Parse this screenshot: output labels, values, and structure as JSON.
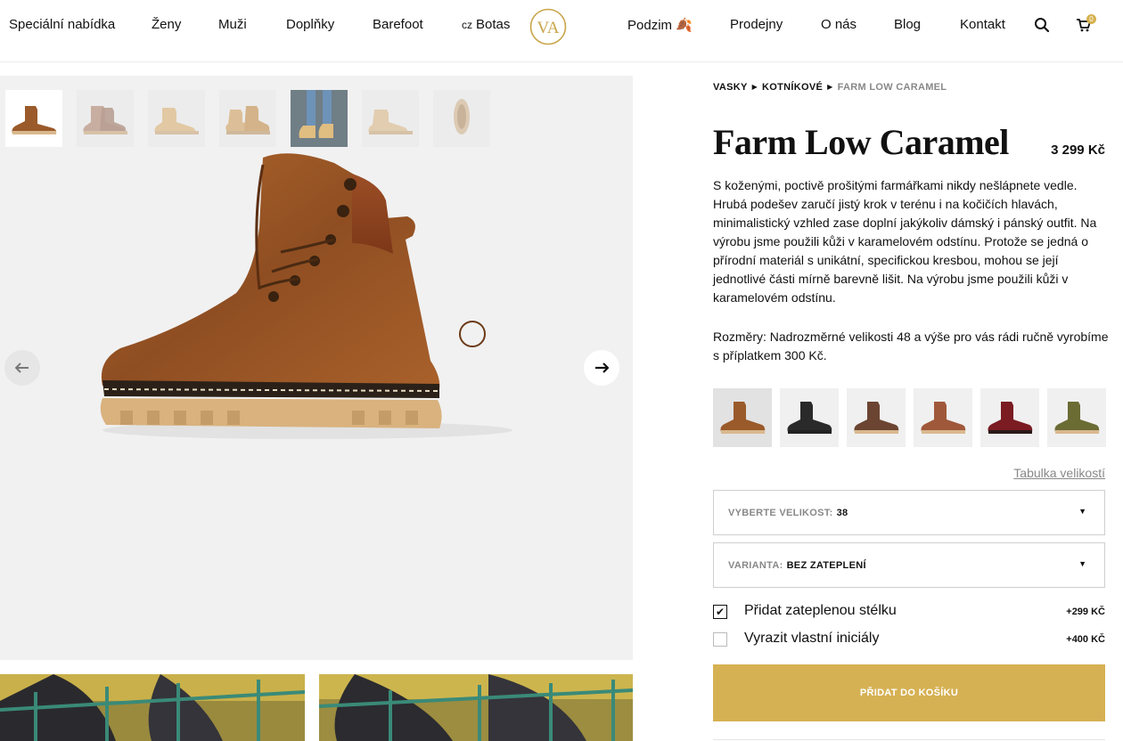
{
  "nav": {
    "left": [
      "Speciální nabídka",
      "Ženy",
      "Muži",
      "Doplňky",
      "Barefoot"
    ],
    "lang_code": "cz",
    "lang_label": "Botas",
    "logo_text": "VA",
    "right": [
      "Podzim 🍂",
      "Prodejny",
      "O nás",
      "Blog",
      "Kontakt"
    ],
    "cart_count": "0"
  },
  "breadcrumb": [
    "VASKY",
    "KOTNÍKOVÉ",
    "FARM LOW CARAMEL"
  ],
  "product": {
    "title": "Farm Low Caramel",
    "price": "3 299 Kč",
    "description": "S koženými, poctivě prošitými farmářkami nikdy nešlápnete vedle. Hrubá podešev zaručí jistý krok v terénu i na kočičích hlavách, minimalistický vzhled zase doplní jakýkoliv dámský i pánský outfit. Na výrobu jsme použili kůži v karamelovém odstínu. Protože se jedná o přírodní materiál s unikátní, specifickou kresbou, mohou se její jednotlivé části mírně barevně lišit. Na výrobu jsme použili kůži v karamelovém odstínu.",
    "dimensions": "Rozměry: Nadrozměrné velikosti 48 a výše pro vás rádi ručně vyrobíme s příplatkem 300 Kč."
  },
  "colors": {
    "swatches": [
      "#9a5a2a",
      "#2a2a2a",
      "#6b4532",
      "#a0583a",
      "#7a1c22",
      "#6b6b34"
    ],
    "accent": "#d6b153"
  },
  "size_table_link": "Tabulka velikostí",
  "size_select": {
    "label": "VYBERTE VELIKOST:",
    "value": "38"
  },
  "variant_select": {
    "label": "VARIANTA:",
    "value": "BEZ ZATEPLENÍ"
  },
  "options": [
    {
      "label": "Přidat zateplenou stélku",
      "price": "+299 KČ",
      "checked": true
    },
    {
      "label": "Vyrazit vlastní iniciály",
      "price": "+400 KČ",
      "checked": false
    }
  ],
  "add_to_cart": "PŘIDAT DO KOŠÍKU"
}
